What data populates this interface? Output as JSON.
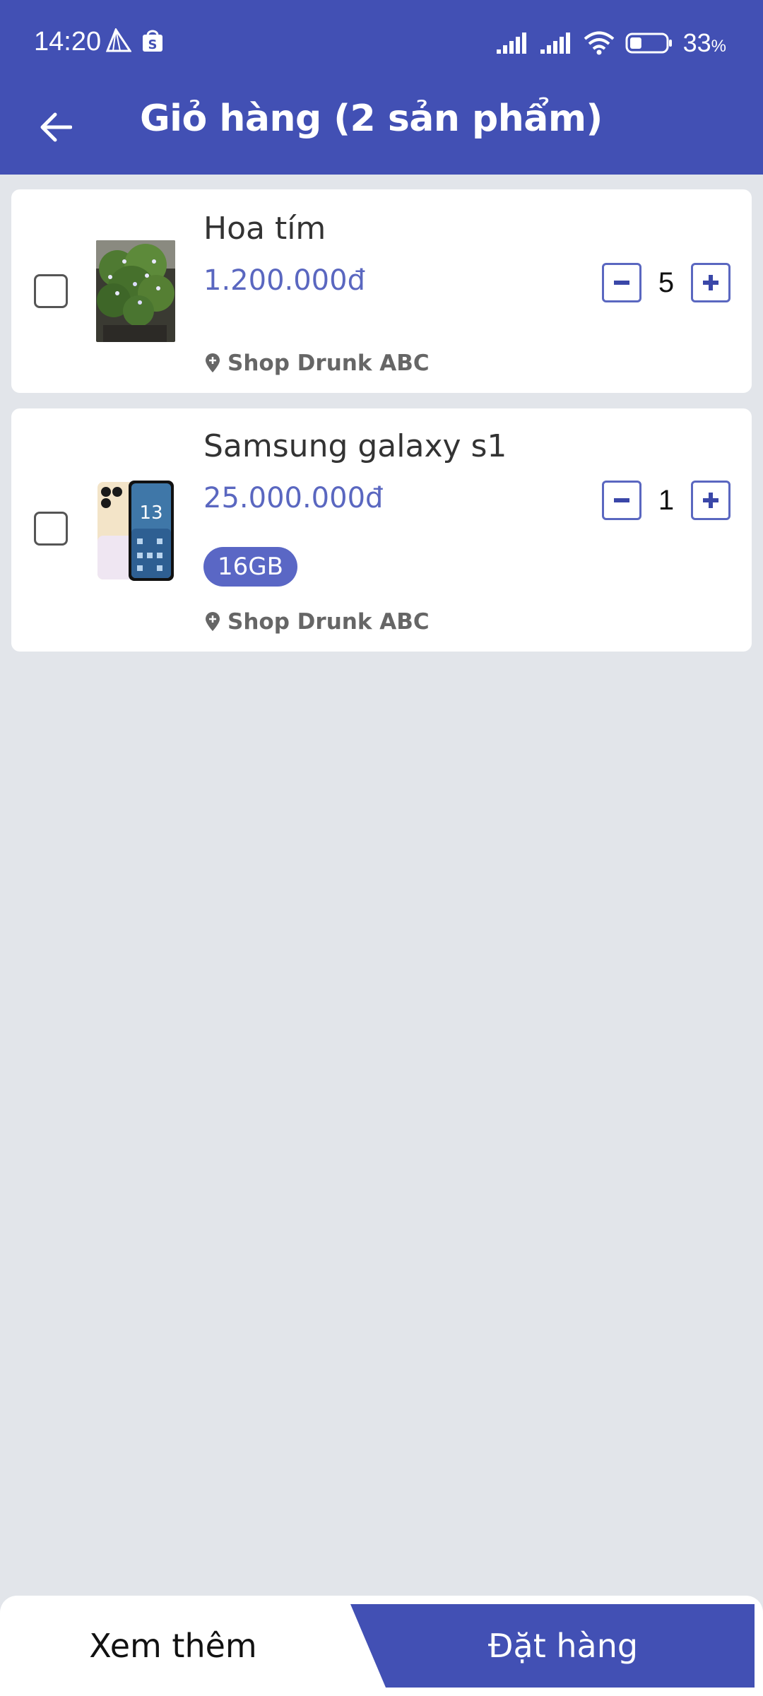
{
  "status_bar": {
    "time": "14:20",
    "battery_percent": "33",
    "battery_unit": "%",
    "battery_level": 0.33,
    "icons": [
      "send-icon",
      "shopee-bag-icon",
      "signal-icon",
      "signal-icon",
      "wifi-icon",
      "battery-icon"
    ]
  },
  "header": {
    "title": "Giỏ hàng (2 sản phẩm)",
    "back_icon": "arrow-left-icon"
  },
  "cart": {
    "items": [
      {
        "name": "Hoa tím",
        "price": "1.200.000đ",
        "quantity": "5",
        "shop": "Shop Drunk ABC",
        "checked": false
      },
      {
        "name": "Samsung galaxy s1",
        "price": "25.000.000đ",
        "variant": "16GB",
        "quantity": "1",
        "shop": "Shop Drunk ABC",
        "checked": false,
        "thumb_clock_text": "13"
      }
    ]
  },
  "footer": {
    "more_label": "Xem thêm",
    "order_label": "Đặt hàng"
  },
  "colors": {
    "primary": "#4250b4",
    "price": "#5a67c0",
    "background": "#e2e5ea"
  }
}
